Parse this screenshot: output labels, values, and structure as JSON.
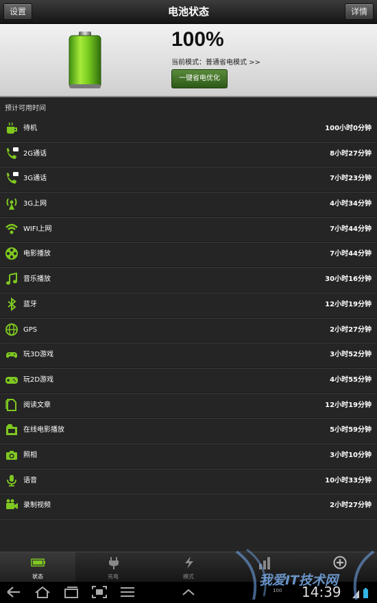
{
  "titlebar": {
    "left_button": "设置",
    "title": "电池状态",
    "right_button": "详情"
  },
  "header": {
    "percent": "100%",
    "mode_text": "当前模式：普通省电模式 >>",
    "optimize_button": "一键省电优化",
    "battery_level": 1.0
  },
  "section_label": "预计可用时间",
  "rows": [
    {
      "icon": "coffee-cup-icon",
      "label": "待机",
      "value": "100小时0分钟"
    },
    {
      "icon": "phone-2g-icon",
      "label": "2G通话",
      "value": "8小时27分钟"
    },
    {
      "icon": "phone-3g-icon",
      "label": "3G通话",
      "value": "7小时23分钟"
    },
    {
      "icon": "antenna-icon",
      "label": "3G上网",
      "value": "4小时34分钟"
    },
    {
      "icon": "wifi-icon",
      "label": "WIFI上网",
      "value": "7小时44分钟"
    },
    {
      "icon": "film-reel-icon",
      "label": "电影播放",
      "value": "7小时44分钟"
    },
    {
      "icon": "music-note-icon",
      "label": "音乐播放",
      "value": "30小时16分钟"
    },
    {
      "icon": "bluetooth-icon",
      "label": "蓝牙",
      "value": "12小时19分钟"
    },
    {
      "icon": "globe-icon",
      "label": "GPS",
      "value": "2小时27分钟"
    },
    {
      "icon": "gamepad-3d-icon",
      "label": "玩3D游戏",
      "value": "3小时52分钟"
    },
    {
      "icon": "gamepad-2d-icon",
      "label": "玩2D游戏",
      "value": "4小时55分钟"
    },
    {
      "icon": "document-icon",
      "label": "阅读文章",
      "value": "12小时19分钟"
    },
    {
      "icon": "online-video-icon",
      "label": "在线电影播放",
      "value": "5小时59分钟"
    },
    {
      "icon": "camera-icon",
      "label": "照相",
      "value": "3小时10分钟"
    },
    {
      "icon": "microphone-icon",
      "label": "语音",
      "value": "10小时33分钟"
    },
    {
      "icon": "video-camera-icon",
      "label": "录制视频",
      "value": "2小时27分钟"
    }
  ],
  "tabs": [
    {
      "label": "状态",
      "icon": "battery-icon",
      "active": true
    },
    {
      "label": "充电",
      "icon": "plug-icon",
      "active": false
    },
    {
      "label": "模式",
      "icon": "lightning-icon",
      "active": false
    },
    {
      "label": "",
      "icon": "bar-chart-icon",
      "active": false
    },
    {
      "label": "",
      "icon": "plus-circle-icon",
      "active": false
    }
  ],
  "statusbar": {
    "time": "14:39",
    "battery_small": "100"
  },
  "watermark": "我爱IT技术网",
  "colors": {
    "accent": "#7fc820",
    "background": "#252525"
  }
}
